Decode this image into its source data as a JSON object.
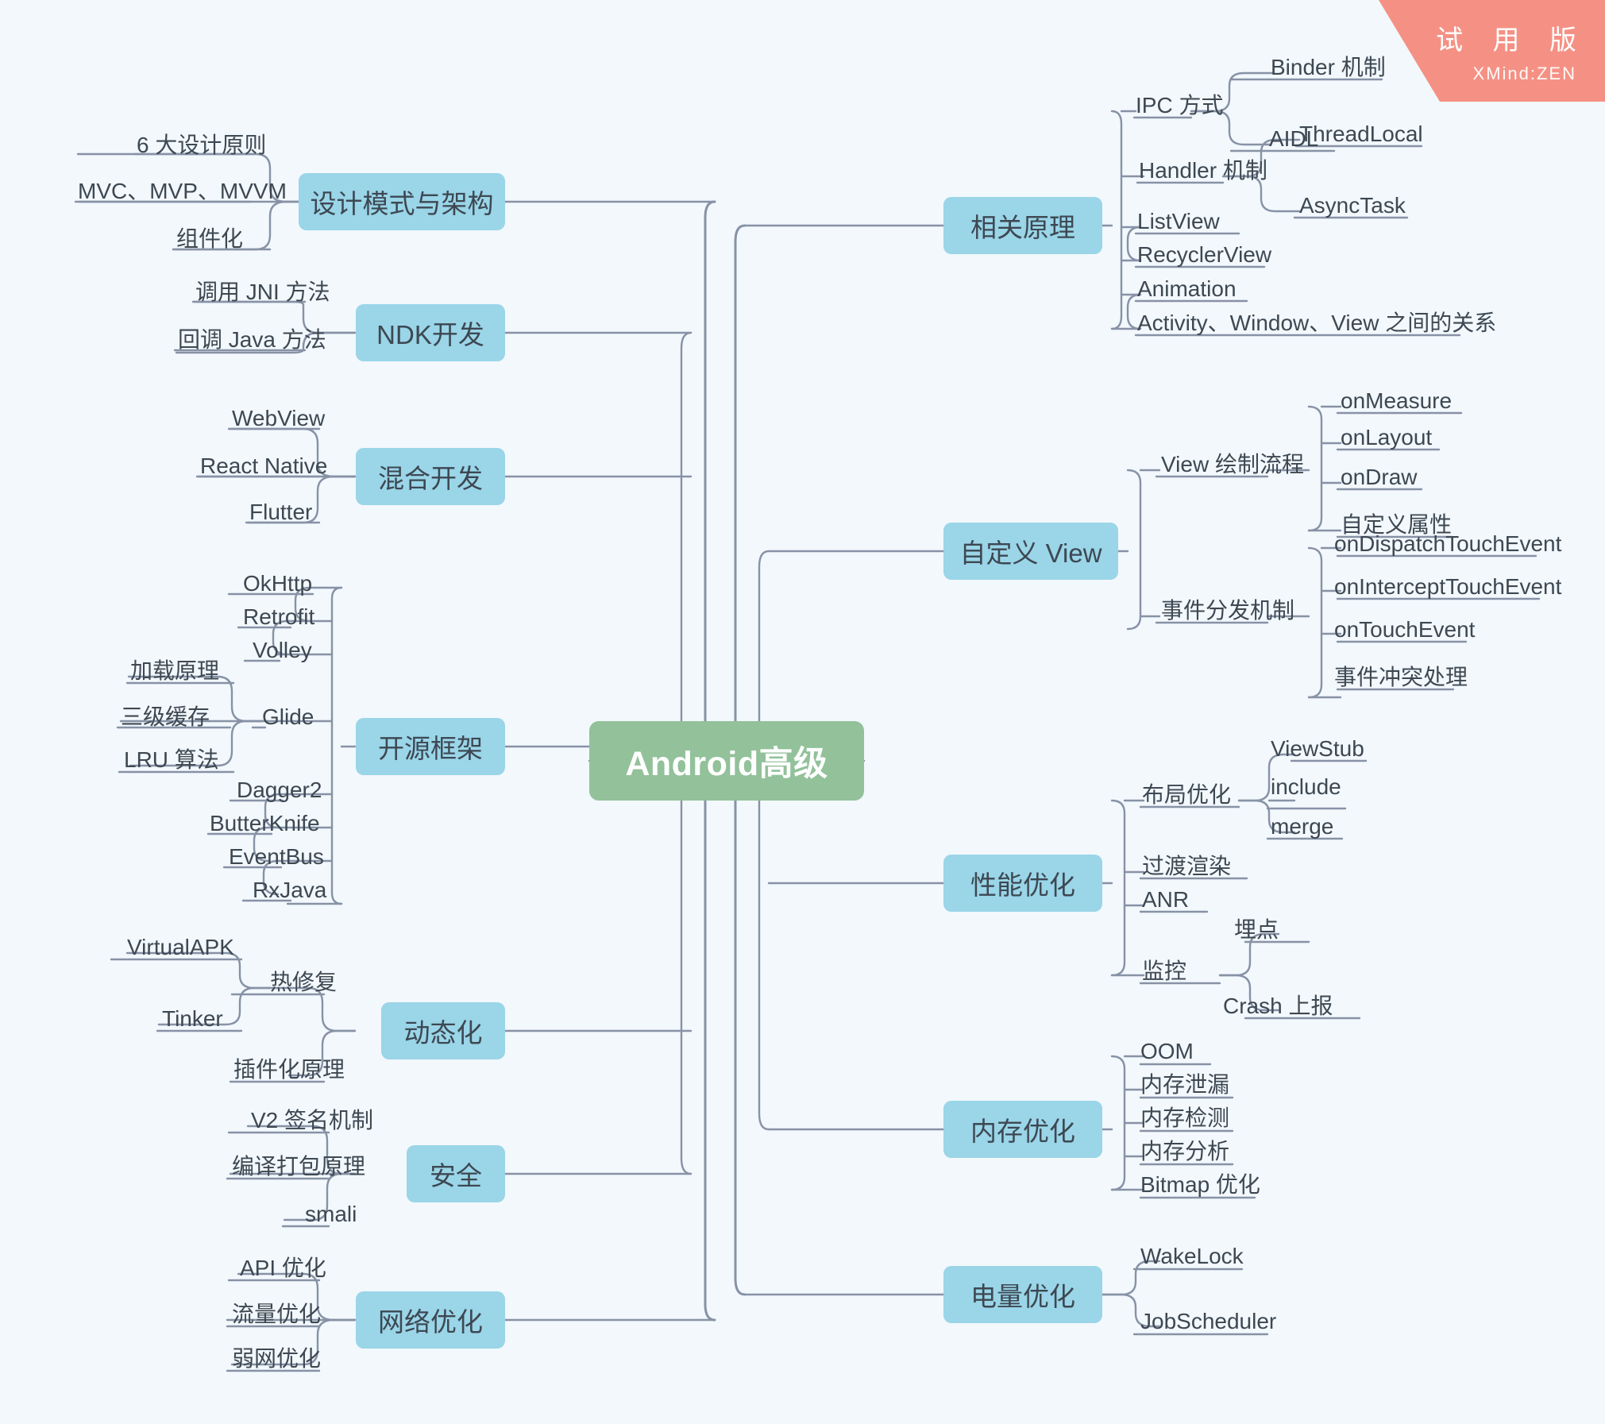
{
  "watermark": {
    "title": "试 用 版",
    "subtitle": "XMind:ZEN"
  },
  "root": {
    "label": "Android高级"
  },
  "branches": {
    "left": [
      {
        "label": "设计模式与架构",
        "children": [
          {
            "label": "6 大设计原则"
          },
          {
            "label": "MVC、MVP、MVVM"
          },
          {
            "label": "组件化"
          }
        ]
      },
      {
        "label": "NDK开发",
        "children": [
          {
            "label": "调用 JNI 方法"
          },
          {
            "label": "回调 Java 方法"
          }
        ]
      },
      {
        "label": "混合开发",
        "children": [
          {
            "label": "WebView"
          },
          {
            "label": "React Native"
          },
          {
            "label": "Flutter"
          }
        ]
      },
      {
        "label": "开源框架",
        "children": [
          {
            "label": "OkHttp"
          },
          {
            "label": "Retrofit"
          },
          {
            "label": "Volley"
          },
          {
            "label": "Glide",
            "children": [
              {
                "label": "加载原理"
              },
              {
                "label": "三级缓存"
              },
              {
                "label": "LRU 算法"
              }
            ]
          },
          {
            "label": "Dagger2"
          },
          {
            "label": "ButterKnife"
          },
          {
            "label": "EventBus"
          },
          {
            "label": "RxJava"
          }
        ]
      },
      {
        "label": "动态化",
        "children": [
          {
            "label": "热修复",
            "children": [
              {
                "label": "VirtualAPK"
              },
              {
                "label": "Tinker"
              }
            ]
          },
          {
            "label": "插件化原理"
          }
        ]
      },
      {
        "label": "安全",
        "children": [
          {
            "label": "V2 签名机制"
          },
          {
            "label": "编译打包原理"
          },
          {
            "label": "smali"
          }
        ]
      },
      {
        "label": "网络优化",
        "children": [
          {
            "label": "API 优化"
          },
          {
            "label": "流量优化"
          },
          {
            "label": "弱网优化"
          }
        ]
      }
    ],
    "right": [
      {
        "label": "相关原理",
        "children": [
          {
            "label": "IPC 方式",
            "children": [
              {
                "label": "Binder 机制"
              },
              {
                "label": "AIDL"
              }
            ]
          },
          {
            "label": "Handler 机制",
            "children": [
              {
                "label": "ThreadLocal"
              },
              {
                "label": "AsyncTask"
              }
            ]
          },
          {
            "label": "ListView"
          },
          {
            "label": "RecyclerView"
          },
          {
            "label": "Animation"
          },
          {
            "label": "Activity、Window、View 之间的关系"
          }
        ]
      },
      {
        "label": "自定义 View",
        "children": [
          {
            "label": "View 绘制流程",
            "children": [
              {
                "label": "onMeasure"
              },
              {
                "label": "onLayout"
              },
              {
                "label": "onDraw"
              },
              {
                "label": "自定义属性"
              }
            ]
          },
          {
            "label": "事件分发机制",
            "children": [
              {
                "label": "onDispatchTouchEvent"
              },
              {
                "label": "onInterceptTouchEvent"
              },
              {
                "label": "onTouchEvent"
              },
              {
                "label": "事件冲突处理"
              }
            ]
          }
        ]
      },
      {
        "label": "性能优化",
        "children": [
          {
            "label": "布局优化",
            "children": [
              {
                "label": "ViewStub"
              },
              {
                "label": "include"
              },
              {
                "label": "merge"
              }
            ]
          },
          {
            "label": "过渡渲染"
          },
          {
            "label": "ANR"
          },
          {
            "label": "监控",
            "children": [
              {
                "label": "埋点"
              },
              {
                "label": "Crash 上报"
              }
            ]
          }
        ]
      },
      {
        "label": "内存优化",
        "children": [
          {
            "label": "OOM"
          },
          {
            "label": "内存泄漏"
          },
          {
            "label": "内存检测"
          },
          {
            "label": "内存分析"
          },
          {
            "label": "Bitmap 优化"
          }
        ]
      },
      {
        "label": "电量优化",
        "children": [
          {
            "label": "WakeLock"
          },
          {
            "label": "JobScheduler"
          }
        ]
      }
    ]
  },
  "colors": {
    "background": "#f2f8fc",
    "root_fill": "#92c19a",
    "root_text": "#ffffff",
    "topic_fill": "#9ad5e8",
    "text": "#3d4852",
    "line": "#8792a6",
    "watermark_fill": "#f59184"
  }
}
